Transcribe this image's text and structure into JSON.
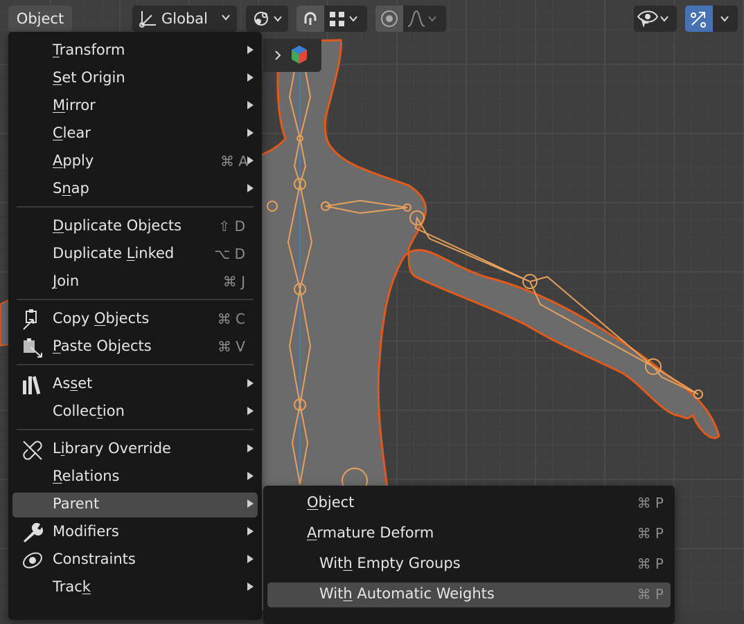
{
  "header": {
    "menu_object": "Object",
    "orientation": "Global",
    "icons": [
      "transform-orientation-icon",
      "pivot-icon",
      "snap-icon",
      "snap-increment-icon",
      "proportional-edit-icon",
      "falloff-icon",
      "visibility-icon",
      "gizmo-icon"
    ]
  },
  "main_menu": {
    "items": [
      {
        "pre": "",
        "u": "T",
        "post": "ransform",
        "shortcut": "",
        "submenu": true
      },
      {
        "pre": "",
        "u": "S",
        "post": "et Origin",
        "shortcut": "",
        "submenu": true
      },
      {
        "pre": "",
        "u": "M",
        "post": "irror",
        "shortcut": "",
        "submenu": true
      },
      {
        "pre": "",
        "u": "C",
        "post": "lear",
        "shortcut": "",
        "submenu": true
      },
      {
        "pre": "",
        "u": "A",
        "post": "pply",
        "shortcut": "⌘ A",
        "submenu": true
      },
      {
        "pre": "S",
        "u": "n",
        "post": "ap",
        "shortcut": "",
        "submenu": true
      },
      {
        "pre": "",
        "u": "D",
        "post": "uplicate Objects",
        "shortcut": "⇧ D",
        "submenu": false
      },
      {
        "pre": "Duplicate ",
        "u": "L",
        "post": "inked",
        "shortcut": "⌥ D",
        "submenu": false
      },
      {
        "pre": "",
        "u": "J",
        "post": "oin",
        "shortcut": "⌘ J",
        "submenu": false
      },
      {
        "pre": "Copy ",
        "u": "O",
        "post": "bjects",
        "shortcut": "⌘ C",
        "submenu": false
      },
      {
        "pre": "",
        "u": "P",
        "post": "aste Objects",
        "shortcut": "⌘ V",
        "submenu": false
      },
      {
        "pre": "As",
        "u": "s",
        "post": "et",
        "shortcut": "",
        "submenu": true
      },
      {
        "pre": "Collec",
        "u": "t",
        "post": "ion",
        "shortcut": "",
        "submenu": true
      },
      {
        "pre": "L",
        "u": "i",
        "post": "brary Override",
        "shortcut": "",
        "submenu": true
      },
      {
        "pre": "",
        "u": "R",
        "post": "elations",
        "shortcut": "",
        "submenu": true
      },
      {
        "pre": "Parent",
        "u": "",
        "post": "",
        "shortcut": "",
        "submenu": true
      },
      {
        "pre": "Modifiers",
        "u": "",
        "post": "",
        "shortcut": "",
        "submenu": true
      },
      {
        "pre": "Constraints",
        "u": "",
        "post": "",
        "shortcut": "",
        "submenu": true
      },
      {
        "pre": "Trac",
        "u": "k",
        "post": "",
        "shortcut": "",
        "submenu": true
      }
    ],
    "icon_names": {
      "9": "copy-icon",
      "10": "paste-icon",
      "11": "asset-icon",
      "13": "library-override-icon",
      "16": "wrench-icon",
      "17": "constraint-icon"
    }
  },
  "sub_menu": {
    "items": [
      {
        "pre": "",
        "u": "O",
        "post": "bject",
        "shortcut": "⌘ P"
      },
      {
        "pre": "",
        "u": "A",
        "post": "rmature Deform",
        "shortcut": "⌘ P"
      },
      {
        "pre": "Wit",
        "u": "h",
        "post": " Empty Groups",
        "shortcut": "⌘ P"
      },
      {
        "pre": "Wit",
        "u": "h",
        "post": " Automatic Weights",
        "shortcut": "⌘ P"
      }
    ]
  },
  "colors": {
    "accent": "#e87d3e",
    "bone": "#e8a05a",
    "highlight": "#4a4a4a",
    "menu_bg": "#181818"
  }
}
